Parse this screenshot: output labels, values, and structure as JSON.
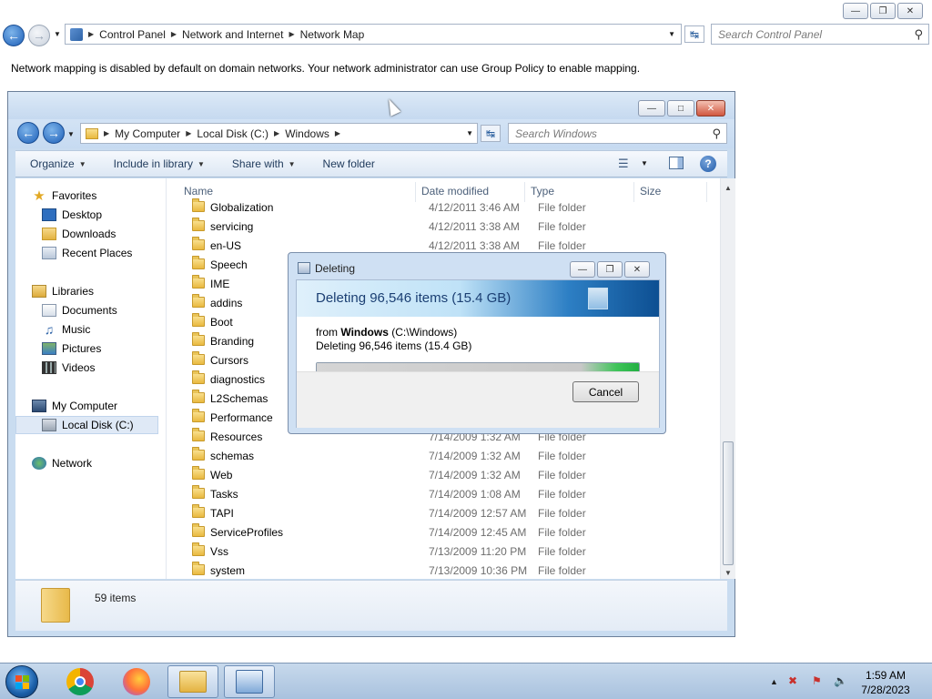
{
  "outer": {
    "breadcrumbs": [
      "Control Panel",
      "Network and Internet",
      "Network Map"
    ],
    "search_placeholder": "Search Control Panel",
    "notice": "Network mapping is disabled by default on domain networks. Your network administrator can use Group Policy to enable mapping."
  },
  "explorer": {
    "breadcrumbs": [
      "My Computer",
      "Local Disk (C:)",
      "Windows"
    ],
    "search_placeholder": "Search Windows",
    "toolbar": {
      "organize": "Organize",
      "include_in_library": "Include in library",
      "share_with": "Share with",
      "new_folder": "New folder"
    },
    "nav": {
      "favorites": "Favorites",
      "desktop": "Desktop",
      "downloads": "Downloads",
      "recent_places": "Recent Places",
      "libraries": "Libraries",
      "documents": "Documents",
      "music": "Music",
      "pictures": "Pictures",
      "videos": "Videos",
      "my_computer": "My Computer",
      "local_disk": "Local Disk (C:)",
      "network": "Network"
    },
    "columns": {
      "name": "Name",
      "date": "Date modified",
      "type": "Type",
      "size": "Size"
    },
    "files": [
      {
        "name": "Globalization",
        "date": "4/12/2011 3:46 AM",
        "type": "File folder"
      },
      {
        "name": "servicing",
        "date": "4/12/2011 3:38 AM",
        "type": "File folder"
      },
      {
        "name": "en-US",
        "date": "4/12/2011 3:38 AM",
        "type": "File folder"
      },
      {
        "name": "Speech",
        "date": "",
        "type": ""
      },
      {
        "name": "IME",
        "date": "",
        "type": ""
      },
      {
        "name": "addins",
        "date": "",
        "type": ""
      },
      {
        "name": "Boot",
        "date": "",
        "type": ""
      },
      {
        "name": "Branding",
        "date": "",
        "type": ""
      },
      {
        "name": "Cursors",
        "date": "",
        "type": ""
      },
      {
        "name": "diagnostics",
        "date": "",
        "type": ""
      },
      {
        "name": "L2Schemas",
        "date": "",
        "type": ""
      },
      {
        "name": "Performance",
        "date": "",
        "type": ""
      },
      {
        "name": "Resources",
        "date": "7/14/2009 1:32 AM",
        "type": "File folder"
      },
      {
        "name": "schemas",
        "date": "7/14/2009 1:32 AM",
        "type": "File folder"
      },
      {
        "name": "Web",
        "date": "7/14/2009 1:32 AM",
        "type": "File folder"
      },
      {
        "name": "Tasks",
        "date": "7/14/2009 1:08 AM",
        "type": "File folder"
      },
      {
        "name": "TAPI",
        "date": "7/14/2009 12:57 AM",
        "type": "File folder"
      },
      {
        "name": "ServiceProfiles",
        "date": "7/14/2009 12:45 AM",
        "type": "File folder"
      },
      {
        "name": "Vss",
        "date": "7/13/2009 11:20 PM",
        "type": "File folder"
      },
      {
        "name": "system",
        "date": "7/13/2009 10:36 PM",
        "type": "File folder"
      }
    ],
    "item_count": "59 items"
  },
  "dialog": {
    "title": "Deleting",
    "headline": "Deleting 96,546 items (15.4 GB)",
    "from_prefix": "from",
    "from_name": "Windows",
    "from_path": "(C:\\Windows)",
    "detail": "Deleting 96,546 items (15.4 GB)",
    "progress_percent": 100,
    "cancel_label": "Cancel"
  },
  "taskbar": {
    "time": "1:59 AM",
    "date": "7/28/2023"
  },
  "colors": {
    "accent": "#1d5fb8",
    "progress_green": "#22b043",
    "taskbar": "#a9c2de"
  }
}
